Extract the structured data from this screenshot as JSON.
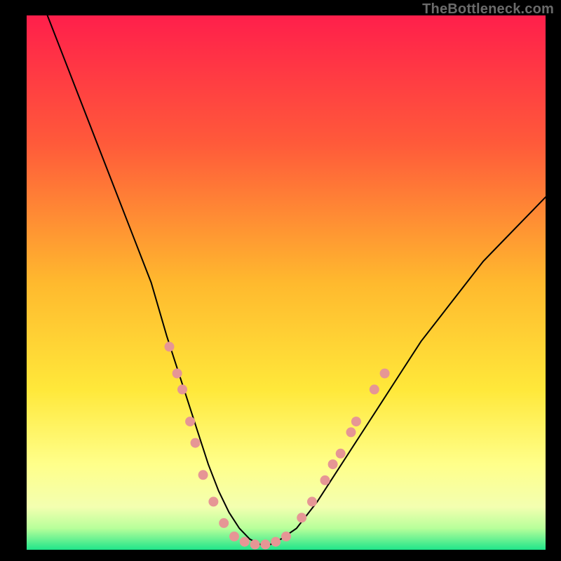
{
  "watermark": "TheBottleneck.com",
  "chart_data": {
    "type": "line",
    "title": "",
    "xlabel": "",
    "ylabel": "",
    "xlim": [
      0,
      100
    ],
    "ylim": [
      0,
      100
    ],
    "grid": false,
    "legend": false,
    "background_gradient": {
      "stops": [
        {
          "pct": 0,
          "color": "#ff1f4b"
        },
        {
          "pct": 24,
          "color": "#ff5a3a"
        },
        {
          "pct": 50,
          "color": "#ffb92e"
        },
        {
          "pct": 70,
          "color": "#ffe83a"
        },
        {
          "pct": 84,
          "color": "#ffff8a"
        },
        {
          "pct": 92,
          "color": "#f3ffb0"
        },
        {
          "pct": 96,
          "color": "#b7ff9a"
        },
        {
          "pct": 100,
          "color": "#20e58a"
        }
      ]
    },
    "series": [
      {
        "name": "bottleneck-curve",
        "color": "#000000",
        "width": 2,
        "x": [
          4,
          8,
          12,
          16,
          20,
          24,
          27,
          29,
          31,
          33,
          35,
          37,
          39,
          41,
          43,
          45,
          47,
          49,
          52,
          56,
          60,
          64,
          68,
          72,
          76,
          80,
          84,
          88,
          92,
          96,
          100
        ],
        "y": [
          100,
          90,
          80,
          70,
          60,
          50,
          40,
          34,
          28,
          22,
          16,
          11,
          7,
          4,
          2,
          1,
          1,
          2,
          4,
          9,
          15,
          21,
          27,
          33,
          39,
          44,
          49,
          54,
          58,
          62,
          66
        ]
      }
    ],
    "markers": {
      "name": "highlight-points",
      "color": "#e69695",
      "radius": 7,
      "points": [
        {
          "x": 27.5,
          "y": 38
        },
        {
          "x": 29,
          "y": 33
        },
        {
          "x": 30,
          "y": 30
        },
        {
          "x": 31.5,
          "y": 24
        },
        {
          "x": 32.5,
          "y": 20
        },
        {
          "x": 34,
          "y": 14
        },
        {
          "x": 36,
          "y": 9
        },
        {
          "x": 38,
          "y": 5
        },
        {
          "x": 40,
          "y": 2.5
        },
        {
          "x": 42,
          "y": 1.5
        },
        {
          "x": 44,
          "y": 1
        },
        {
          "x": 46,
          "y": 1
        },
        {
          "x": 48,
          "y": 1.5
        },
        {
          "x": 50,
          "y": 2.5
        },
        {
          "x": 53,
          "y": 6
        },
        {
          "x": 55,
          "y": 9
        },
        {
          "x": 57.5,
          "y": 13
        },
        {
          "x": 59,
          "y": 16
        },
        {
          "x": 60.5,
          "y": 18
        },
        {
          "x": 62.5,
          "y": 22
        },
        {
          "x": 63.5,
          "y": 24
        },
        {
          "x": 67,
          "y": 30
        },
        {
          "x": 69,
          "y": 33
        }
      ]
    }
  }
}
